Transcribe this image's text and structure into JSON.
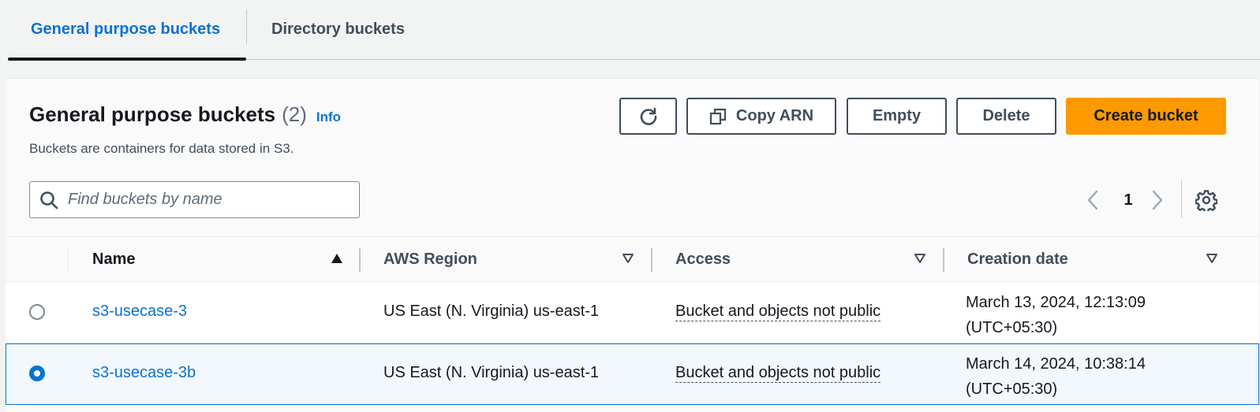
{
  "tabs": [
    {
      "label": "General purpose buckets",
      "active": true
    },
    {
      "label": "Directory buckets",
      "active": false
    }
  ],
  "header": {
    "title": "General purpose buckets",
    "count": "(2)",
    "info": "Info",
    "description": "Buckets are containers for data stored in S3."
  },
  "actions": {
    "refresh_icon": "refresh-icon",
    "copy_arn": "Copy ARN",
    "copy_icon": "copy-icon",
    "empty": "Empty",
    "delete": "Delete",
    "create": "Create bucket"
  },
  "search": {
    "placeholder": "Find buckets by name",
    "value": ""
  },
  "pagination": {
    "current_page": "1"
  },
  "table": {
    "columns": [
      {
        "label": "Name",
        "sort": "ascending"
      },
      {
        "label": "AWS Region",
        "sort": "none"
      },
      {
        "label": "Access",
        "sort": "none"
      },
      {
        "label": "Creation date",
        "sort": "none"
      }
    ],
    "rows": [
      {
        "name": "s3-usecase-3",
        "region": "US East (N. Virginia) us-east-1",
        "access": "Bucket and objects not public",
        "date_line1": "March 13, 2024, 12:13:09",
        "date_line2": "(UTC+05:30)",
        "selected": false
      },
      {
        "name": "s3-usecase-3b",
        "region": "US East (N. Virginia) us-east-1",
        "access": "Bucket and objects not public",
        "date_line1": "March 14, 2024, 10:38:14",
        "date_line2": "(UTC+05:30)",
        "selected": true
      }
    ]
  },
  "colors": {
    "accent": "#0972d3",
    "primary_button": "#ff9900",
    "text": "#16191f",
    "muted": "#414d5c"
  }
}
